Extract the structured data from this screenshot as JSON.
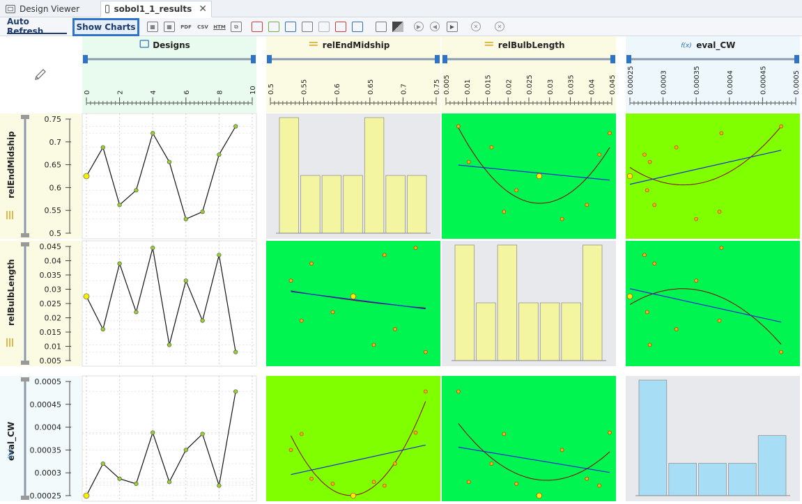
{
  "tabs": [
    {
      "label": "Design Viewer",
      "icon": "table-icon"
    },
    {
      "label": "sobol1_1_results",
      "icon": "window-icon",
      "active": true
    }
  ],
  "toolbar": {
    "auto_refresh_label": "Auto Refresh",
    "show_charts_label": "Show Charts",
    "icon_labels": {
      "pdf": "PDF",
      "csv": "CSV",
      "htm": "HTM"
    }
  },
  "columns": [
    {
      "label": "Designs",
      "icon": "folder-icon",
      "icon_color": "#2a6fbf",
      "bg": "#e8fbee",
      "ticks": [
        "0",
        "2",
        "4",
        "6",
        "8",
        "10"
      ],
      "range": [
        0,
        10
      ]
    },
    {
      "label": "relEndMidship",
      "icon": "slider-icon",
      "icon_color": "#d9a21b",
      "bg": "#fbfbe3",
      "ticks": [
        "0.5",
        "0.55",
        "0.6",
        "0.65",
        "0.7",
        "0.75"
      ],
      "range": [
        0.5,
        0.75
      ]
    },
    {
      "label": "relBulbLength",
      "icon": "slider-icon",
      "icon_color": "#d9a21b",
      "bg": "#fbfbe3",
      "ticks": [
        "0.005",
        "0.01",
        "0.015",
        "0.02",
        "0.025",
        "0.03",
        "0.035",
        "0.04",
        "0.045"
      ],
      "range": [
        0.005,
        0.045
      ]
    },
    {
      "label": "eval_CW",
      "icon": "function-icon",
      "icon_prefix": "f(x)",
      "icon_color": "#2a6fbf",
      "bg": "#eef8fc",
      "ticks": [
        "0.00025",
        "0.0003",
        "0.00035",
        "0.0004",
        "0.00045",
        "0.0005"
      ],
      "range": [
        0.00025,
        0.0005
      ]
    }
  ],
  "rows": [
    {
      "label": "relEndMidship",
      "icon": "slider-icon",
      "ticks": [
        "0.75",
        "0.7",
        "0.65",
        "0.6",
        "0.55",
        "0.5"
      ],
      "range": [
        0.5,
        0.75
      ]
    },
    {
      "label": "relBulbLength",
      "icon": "slider-icon",
      "ticks": [
        "0.045",
        "0.04",
        "0.035",
        "0.03",
        "0.025",
        "0.02",
        "0.015",
        "0.01",
        "0.005"
      ],
      "range": [
        0.005,
        0.045
      ]
    },
    {
      "label": "eval_CW",
      "icon": "function-icon",
      "icon_prefix": "f(x)",
      "ticks": [
        "0.0005",
        "0.00045",
        "0.0004",
        "0.00035",
        "0.0003",
        "0.00025"
      ],
      "range": [
        0.00025,
        0.0005
      ]
    }
  ],
  "colors": {
    "strong_correlation_bg": "#00f550",
    "moderate_correlation_bg": "#7fff00",
    "diagonal_bg": "#e8e9ec",
    "histogram_input_fill": "#f3f5a0",
    "histogram_output_fill": "#a8def5",
    "linear_fit": "#1a2bd6",
    "quadratic_fit": "#8b0000",
    "point_fill": "#f5f000",
    "point_fill_series": "#9acd32"
  },
  "chart_data": {
    "type": "scatter",
    "designs": [
      0,
      1,
      2,
      3,
      4,
      5,
      6,
      7,
      8,
      9
    ],
    "series": [
      {
        "name": "relEndMidship",
        "values": [
          0.625,
          0.688,
          0.562,
          0.594,
          0.719,
          0.656,
          0.531,
          0.547,
          0.672,
          0.734
        ]
      },
      {
        "name": "relBulbLength",
        "values": [
          0.0275,
          0.016,
          0.039,
          0.022,
          0.0445,
          0.0105,
          0.033,
          0.019,
          0.042,
          0.008
        ]
      },
      {
        "name": "eval_CW",
        "values": [
          0.00025,
          0.00032,
          0.000287,
          0.000276,
          0.000388,
          0.00028,
          0.00035,
          0.000385,
          0.000272,
          0.000478
        ]
      }
    ],
    "histograms": {
      "relEndMidship": [
        6,
        3,
        3,
        3,
        6,
        3,
        3
      ],
      "relBulbLength": [
        6,
        3,
        6,
        3,
        3,
        3,
        6
      ],
      "eval_CW": [
        5,
        1.4,
        1.4,
        1.4,
        2.6
      ]
    }
  }
}
